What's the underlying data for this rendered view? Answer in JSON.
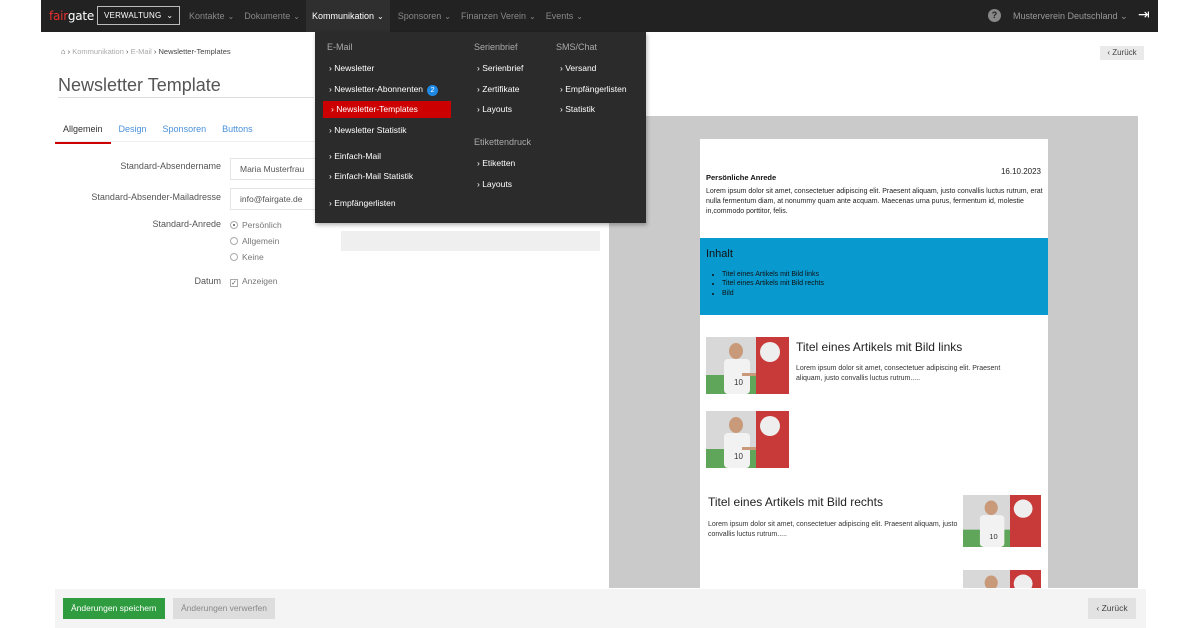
{
  "topbar": {
    "logo_fair": "fair",
    "logo_gate": "gate",
    "module": "VERWALTUNG",
    "nav": [
      "Kontakte",
      "Dokumente",
      "Kommunikation",
      "Sponsoren",
      "Finanzen Verein",
      "Events"
    ],
    "active_nav": "Kommunikation",
    "help": "?",
    "club": "Musterverein Deutschland",
    "colors": {
      "bar": "#222222",
      "accent": "#e8312f"
    }
  },
  "breadcrumb": {
    "home_icon": "home-icon",
    "items": [
      "Kommunikation",
      "E-Mail",
      "Newsletter-Templates"
    ]
  },
  "back_label": "Zurück",
  "page_title": "Newsletter Template",
  "tabs": [
    "Allgemein",
    "Design",
    "Sponsoren",
    "Buttons"
  ],
  "active_tab": "Allgemein",
  "form": {
    "sender_name_label": "Standard-Absendername",
    "sender_name_value": "Maria Musterfrau",
    "sender_mail_label": "Standard-Absender-Mailadresse",
    "sender_mail_value": "info@fairgate.de",
    "salutation_label": "Standard-Anrede",
    "salutation_options": [
      "Persönlich",
      "Allgemein",
      "Keine"
    ],
    "salutation_selected": "Persönlich",
    "date_label": "Datum",
    "date_option": "Anzeigen",
    "date_checked": true
  },
  "menu": {
    "email_header": "E-Mail",
    "email_items": [
      "Newsletter",
      "Newsletter-Abonnenten",
      "Newsletter-Templates",
      "Newsletter Statistik",
      "Einfach-Mail",
      "Einfach-Mail Statistik",
      "Empfängerlisten"
    ],
    "subscriber_badge": "2",
    "selected_item": "Newsletter-Templates",
    "serienbrief_header": "Serienbrief",
    "serienbrief_items": [
      "Serienbrief",
      "Zertifikate",
      "Layouts"
    ],
    "etiketten_header": "Etikettendruck",
    "etiketten_items": [
      "Etiketten",
      "Layouts"
    ],
    "sms_header": "SMS/Chat",
    "sms_items": [
      "Versand",
      "Empfängerlisten",
      "Statistik"
    ],
    "colors": {
      "background": "#2b2b2b",
      "selected": "#cc0000"
    }
  },
  "preview": {
    "salutation": "Persönliche Anrede",
    "date": "16.10.2023",
    "intro": "Lorem ipsum dolor sit amet, consectetuer adipiscing elit. Praesent aliquam, justo convallis luctus rutrum, erat nulla fermentum diam, at nonummy quam ante acquam. Maecenas urna purus, fermentum id, molestie in,commodo porttitor, felis.",
    "contents_title": "Inhalt",
    "contents_items": [
      "Titel eines Artikels mit Bild links",
      "Titel eines Artikels mit Bild rechts",
      "Bild"
    ],
    "article1_title": "Titel eines Artikels mit Bild links",
    "article1_text": "Lorem ipsum dolor sit amet, consectetuer adipiscing elit. Praesent aliquam, justo convallis luctus rutrum.....",
    "article2_title": "Titel eines Artikels mit Bild rechts",
    "article2_text": "Lorem ipsum dolor sit amet, consectetuer adipiscing elit. Praesent aliquam, justo convallis luctus rutrum.....",
    "colors": {
      "contents_band": "#0899cf",
      "canvas": "#cacaca"
    }
  },
  "footer": {
    "save": "Änderungen speichern",
    "discard": "Änderungen verwerfen",
    "back": "Zurück",
    "colors": {
      "save": "#2e9c3f"
    }
  }
}
